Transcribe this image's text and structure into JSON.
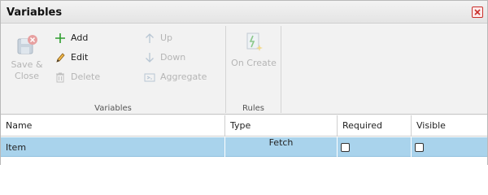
{
  "window": {
    "title": "Variables"
  },
  "ribbon": {
    "groups": [
      {
        "label": "Variables"
      },
      {
        "label": "Rules"
      }
    ],
    "save_close": {
      "line1": "Save &",
      "line2": "Close"
    },
    "add": "Add",
    "edit": "Edit",
    "delete": "Delete",
    "up": "Up",
    "down": "Down",
    "aggregate": "Aggregate",
    "on_create": "On Create"
  },
  "grid": {
    "columns": [
      "Name",
      "Type",
      "Required",
      "Visible"
    ],
    "rows": [
      {
        "name": "Item",
        "type": "Fetch",
        "required": false,
        "visible": false
      }
    ]
  },
  "colors": {
    "selected_row": "#a9d3ec",
    "close_red": "#c9302c",
    "add_green": "#2e9d2e"
  }
}
